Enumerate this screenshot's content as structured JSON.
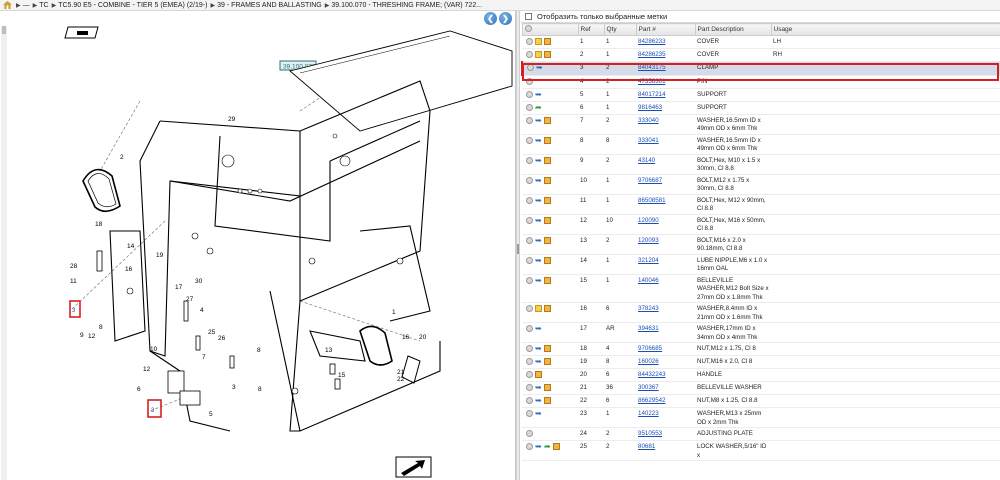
{
  "breadcrumb": {
    "items": [
      "— ",
      "TC",
      "TC5.90 E5 - COMBINE - TIER 5 (EMEA) (2/19-)",
      "39 - FRAMES AND BALLASTING",
      "39.100.070 - THRESHING FRAME; (VAR) 722..."
    ]
  },
  "diagram": {
    "ref_label": "39.100.070",
    "callouts": [
      "2",
      "29",
      "18",
      "14",
      "16",
      "19",
      "28",
      "11",
      "9",
      "8",
      "12",
      "30",
      "17",
      "4",
      "27",
      "25",
      "26",
      "7",
      "10",
      "12",
      "6",
      "5",
      "8",
      "3",
      "13",
      "15",
      "16",
      "20",
      "21",
      "22",
      "1",
      "8"
    ]
  },
  "filter": {
    "label": "Отобразить только выбранные метки"
  },
  "table": {
    "headers": {
      "ref": "Ref",
      "qty": "Qty",
      "part": "Part #",
      "desc": "Part Description",
      "usage": "Usage"
    },
    "rows": [
      {
        "ref": "1",
        "qty": "1",
        "part": "84286233",
        "desc": "COVER",
        "usage": "LH",
        "icons": [
          "circ",
          "note",
          "cube"
        ]
      },
      {
        "ref": "2",
        "qty": "1",
        "part": "84286235",
        "desc": "COVER",
        "usage": "RH",
        "icons": [
          "circ",
          "note",
          "cube"
        ]
      },
      {
        "ref": "3",
        "qty": "2",
        "part": "84043175",
        "desc": "CLAMP",
        "usage": "",
        "icons": [
          "circ",
          "blue"
        ],
        "highlight": true
      },
      {
        "ref": "4",
        "qty": "2",
        "part": "47358301",
        "desc": "PIN",
        "usage": "",
        "icons": [
          "circ"
        ]
      },
      {
        "ref": "5",
        "qty": "1",
        "part": "84017214",
        "desc": "SUPPORT",
        "usage": "",
        "icons": [
          "circ",
          "blue"
        ]
      },
      {
        "ref": "6",
        "qty": "1",
        "part": "9816463",
        "desc": "SUPPORT",
        "usage": "",
        "icons": [
          "circ",
          "green"
        ]
      },
      {
        "ref": "7",
        "qty": "2",
        "part": "333040",
        "desc": "WASHER,16.5mm ID x 49mm OD x 6mm Thk",
        "usage": "",
        "icons": [
          "circ",
          "blue",
          "cube"
        ]
      },
      {
        "ref": "8",
        "qty": "8",
        "part": "333041",
        "desc": "WASHER,16.5mm ID x 49mm OD x 6mm Thk",
        "usage": "",
        "icons": [
          "circ",
          "blue",
          "cube"
        ]
      },
      {
        "ref": "9",
        "qty": "2",
        "part": "43140",
        "desc": "BOLT,Hex, M10 x 1.5 x 30mm, Cl 8.8",
        "usage": "",
        "icons": [
          "circ",
          "blue",
          "cube"
        ]
      },
      {
        "ref": "10",
        "qty": "1",
        "part": "9706687",
        "desc": "BOLT,M12 x 1.75 x 30mm, Cl 8.8",
        "usage": "",
        "icons": [
          "circ",
          "blue",
          "cube"
        ]
      },
      {
        "ref": "11",
        "qty": "1",
        "part": "86508581",
        "desc": "BOLT,Hex, M12 x 90mm, Cl 8.8",
        "usage": "",
        "icons": [
          "circ",
          "blue",
          "cube"
        ]
      },
      {
        "ref": "12",
        "qty": "10",
        "part": "120090",
        "desc": "BOLT,Hex, M16 x 50mm, Cl 8.8",
        "usage": "",
        "icons": [
          "circ",
          "blue",
          "cube"
        ]
      },
      {
        "ref": "13",
        "qty": "2",
        "part": "120093",
        "desc": "BOLT,M16 x 2.0 x 90.18mm, Cl 8.8",
        "usage": "",
        "icons": [
          "circ",
          "blue",
          "cube"
        ]
      },
      {
        "ref": "14",
        "qty": "1",
        "part": "321204",
        "desc": "LUBE NIPPLE,M6 x 1.0 x 16mm OAL",
        "usage": "",
        "icons": [
          "circ",
          "blue",
          "cube"
        ]
      },
      {
        "ref": "15",
        "qty": "1",
        "part": "140046",
        "desc": "BELLEVILLE WASHER,M12 Bolt Size x 27mm OD x 1.8mm Thk",
        "usage": "",
        "icons": [
          "circ",
          "blue",
          "cube"
        ]
      },
      {
        "ref": "16",
        "qty": "6",
        "part": "378243",
        "desc": "WASHER,8.4mm ID x 21mm OD x 1.6mm Thk",
        "usage": "",
        "icons": [
          "circ",
          "note",
          "cube"
        ]
      },
      {
        "ref": "17",
        "qty": "AR",
        "part": "394631",
        "desc": "WASHER,17mm ID x 34mm OD x 4mm Thk",
        "usage": "",
        "icons": [
          "circ",
          "blue"
        ]
      },
      {
        "ref": "18",
        "qty": "4",
        "part": "9706685",
        "desc": "NUT,M12 x 1.75, Cl 8",
        "usage": "",
        "icons": [
          "circ",
          "blue",
          "cube"
        ]
      },
      {
        "ref": "19",
        "qty": "8",
        "part": "160026",
        "desc": "NUT,M16 x 2.0, Cl 8",
        "usage": "",
        "icons": [
          "circ",
          "blue",
          "cube"
        ]
      },
      {
        "ref": "20",
        "qty": "6",
        "part": "84432243",
        "desc": "HANDLE",
        "usage": "",
        "icons": [
          "circ",
          "cube"
        ]
      },
      {
        "ref": "21",
        "qty": "36",
        "part": "300367",
        "desc": "BELLEVILLE WASHER",
        "usage": "",
        "icons": [
          "circ",
          "blue",
          "cube"
        ]
      },
      {
        "ref": "22",
        "qty": "6",
        "part": "86629542",
        "desc": "NUT,M8 x 1.25, Cl 8.8",
        "usage": "",
        "icons": [
          "circ",
          "blue",
          "cube"
        ]
      },
      {
        "ref": "23",
        "qty": "1",
        "part": "140223",
        "desc": "WASHER,M13 x 25mm OD x 2mm Thk",
        "usage": "",
        "icons": [
          "circ",
          "blue"
        ]
      },
      {
        "ref": "24",
        "qty": "2",
        "part": "9510553",
        "desc": "ADJUSTING PLATE",
        "usage": "",
        "icons": [
          "circ"
        ]
      },
      {
        "ref": "25",
        "qty": "2",
        "part": "80681",
        "desc": "LOCK WASHER,5/16\" ID x",
        "usage": "",
        "icons": [
          "circ",
          "blue",
          "green",
          "cube"
        ]
      }
    ]
  }
}
